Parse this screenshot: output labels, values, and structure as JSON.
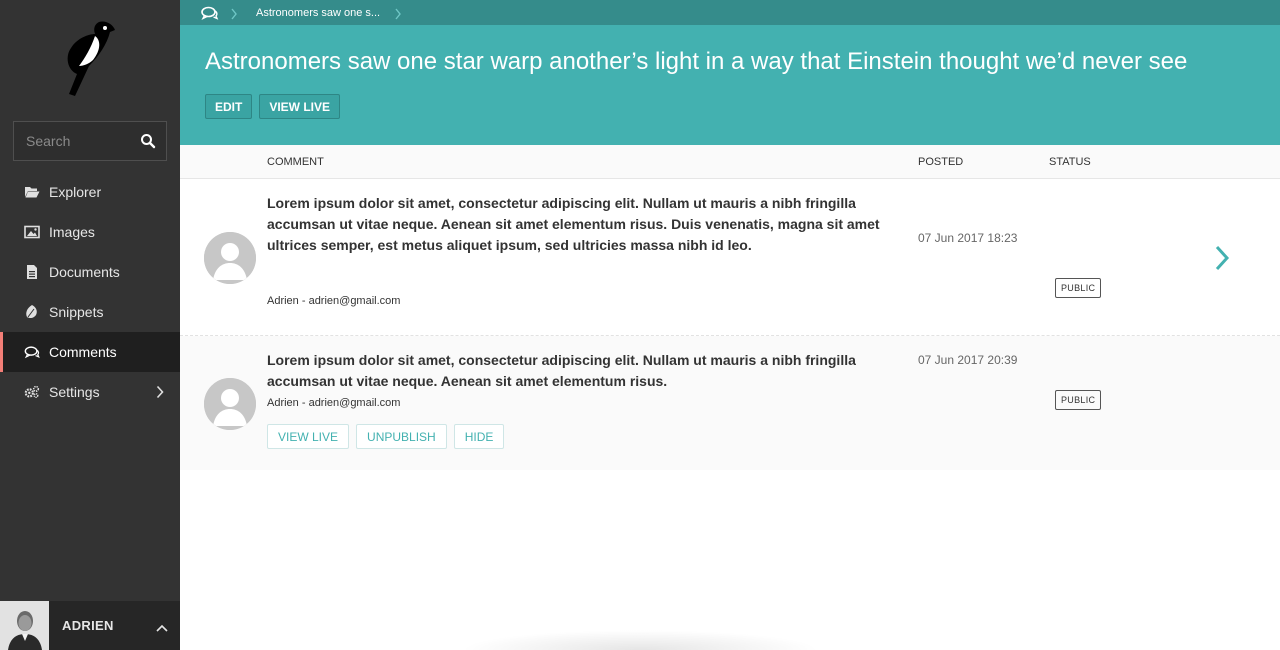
{
  "sidebar": {
    "search": {
      "placeholder": "Search"
    },
    "items": [
      {
        "label": "Explorer",
        "icon": "folder-open-icon"
      },
      {
        "label": "Images",
        "icon": "image-icon"
      },
      {
        "label": "Documents",
        "icon": "document-icon"
      },
      {
        "label": "Snippets",
        "icon": "snippet-icon"
      },
      {
        "label": "Comments",
        "icon": "comments-icon",
        "active": true
      },
      {
        "label": "Settings",
        "icon": "cogs-icon",
        "has_submenu": true
      }
    ],
    "account": {
      "name": "ADRIEN"
    },
    "active_indicator_color": "#f37e77"
  },
  "header": {
    "breadcrumb": {
      "current": "Astronomers saw one s..."
    },
    "title": "Astronomers saw one star warp another’s light in a way that Einstein thought we’d never see",
    "actions": {
      "edit": "EDIT",
      "view_live": "VIEW LIVE"
    },
    "color": "#43b1b0"
  },
  "table": {
    "columns": {
      "comment": "COMMENT",
      "posted": "POSTED",
      "status": "STATUS"
    },
    "rows": [
      {
        "text": "Lorem ipsum dolor sit amet, consectetur adipiscing elit. Nullam ut mauris a nibh fringilla accumsan ut vitae neque. Aenean sit amet elementum risus. Duis venenatis, magna sit amet ultrices semper, est metus aliquet ipsum, sed ultricies massa nibh id leo.",
        "author": "Adrien - adrien@gmail.com",
        "posted": "07 Jun 2017 18:23",
        "status": "PUBLIC"
      },
      {
        "text": "Lorem ipsum dolor sit amet, consectetur adipiscing elit. Nullam ut mauris a nibh fringilla accumsan ut vitae neque. Aenean sit amet elementum risus.",
        "author": "Adrien - adrien@gmail.com",
        "posted": "07 Jun 2017 20:39",
        "status": "PUBLIC",
        "actions": {
          "view_live": "VIEW LIVE",
          "unpublish": "UNPUBLISH",
          "hide": "HIDE"
        }
      }
    ]
  }
}
